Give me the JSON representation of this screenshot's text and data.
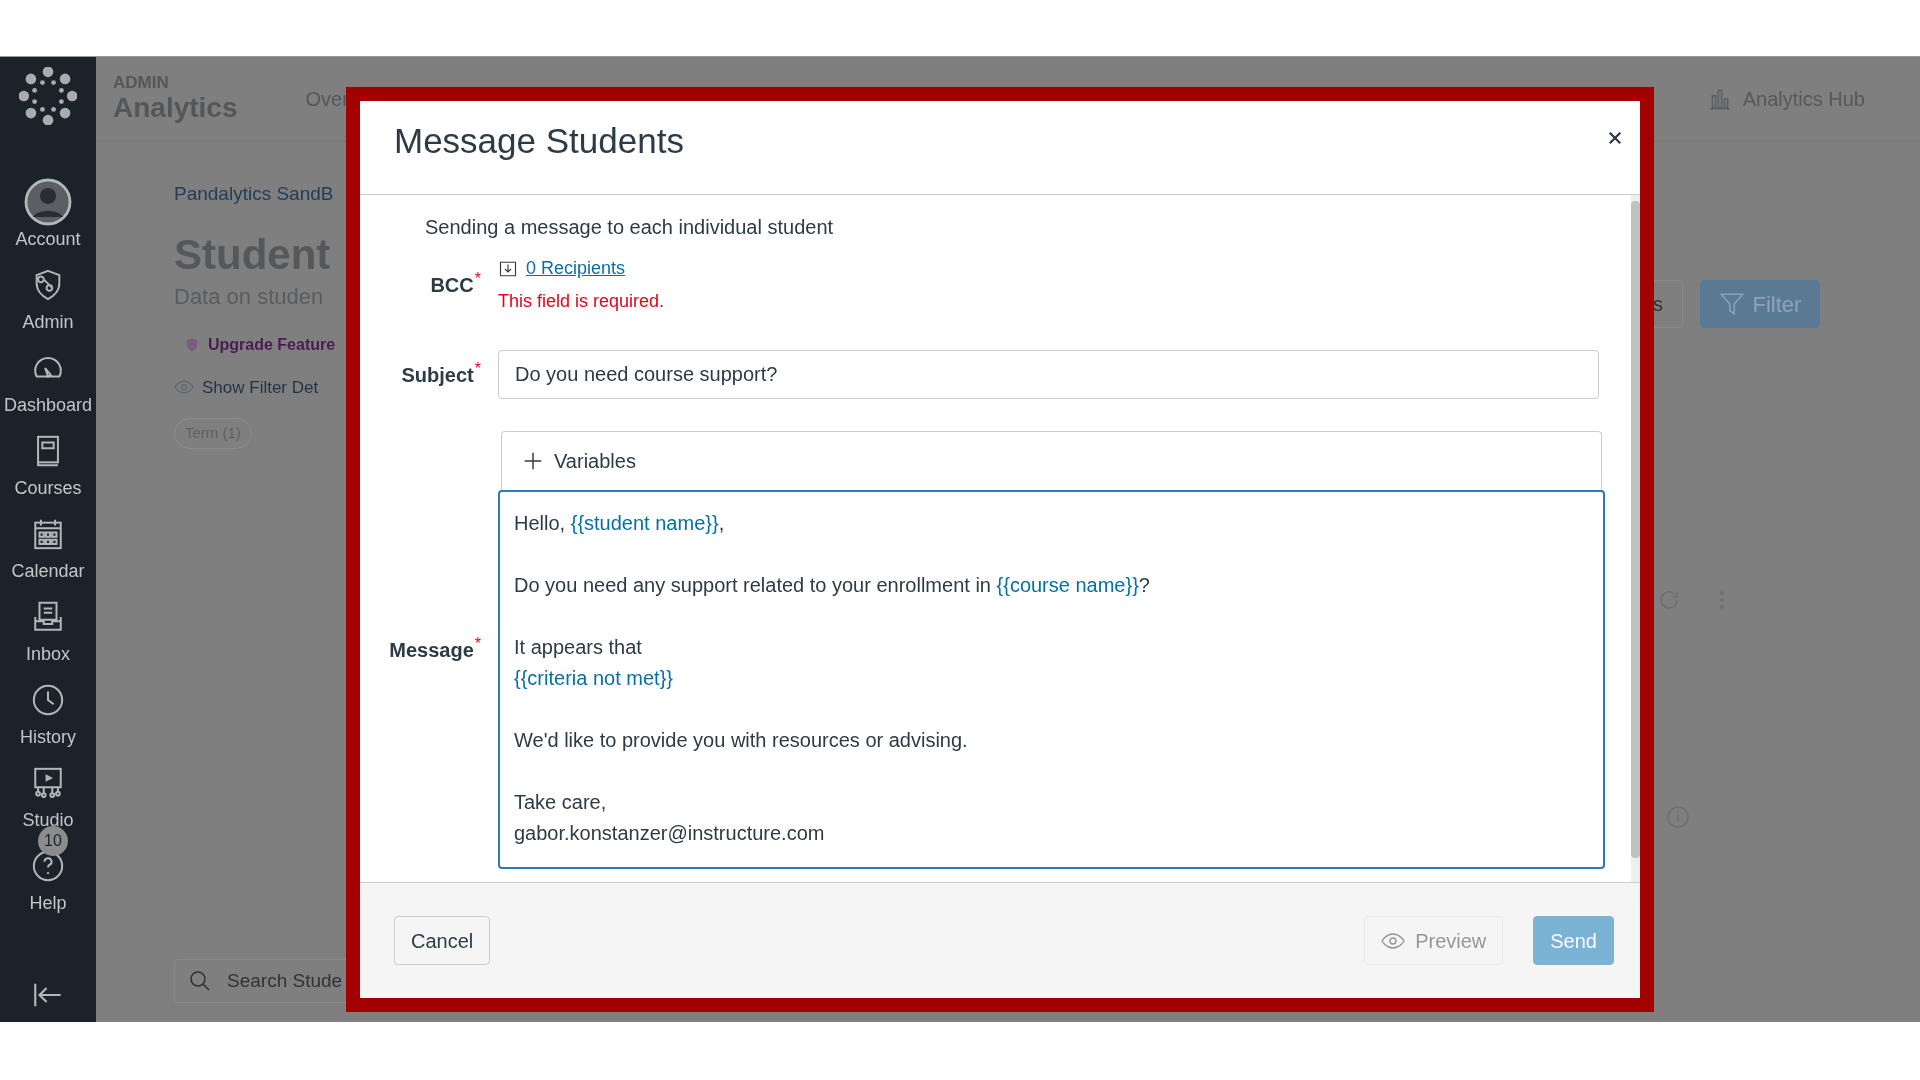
{
  "sidebar": {
    "items": [
      {
        "label": "Account",
        "kind": "account"
      },
      {
        "label": "Admin",
        "kind": "admin"
      },
      {
        "label": "Dashboard",
        "kind": "dashboard"
      },
      {
        "label": "Courses",
        "kind": "courses"
      },
      {
        "label": "Calendar",
        "kind": "calendar"
      },
      {
        "label": "Inbox",
        "kind": "inbox"
      },
      {
        "label": "History",
        "kind": "history"
      },
      {
        "label": "Studio",
        "kind": "studio"
      },
      {
        "label": "Help",
        "kind": "help",
        "badge": "10"
      }
    ]
  },
  "header": {
    "overline": "ADMIN",
    "title": "Analytics",
    "nav_tab": "Over",
    "hub_link": "Analytics Hub"
  },
  "page": {
    "breadcrumb": "Pandalytics SandB",
    "heading": "Student",
    "subheading": "Data on studen",
    "upgrade": "Upgrade Feature",
    "filter_details": "Show Filter Det",
    "term_chip": "Term (1)",
    "partial_button": "s",
    "filter_button": "Filter",
    "search": {
      "placeholder": "Search Stude"
    }
  },
  "modal": {
    "title": "Message Students",
    "intro": "Sending a message to each individual student",
    "bcc": {
      "label": "BCC",
      "required_mark": "*",
      "recipients": "0 Recipients",
      "error": "This field is required."
    },
    "subject": {
      "label": "Subject",
      "required_mark": "*",
      "value": "Do you need course support?"
    },
    "variables_button": "Variables",
    "message": {
      "label": "Message",
      "required_mark": "*",
      "focused": true,
      "paragraphs": [
        {
          "lines": [
            {
              "segments": [
                {
                  "kind": "plain",
                  "text": "Hello, "
                },
                {
                  "kind": "variable",
                  "text": "{{student name}}"
                },
                {
                  "kind": "plain",
                  "text": ","
                }
              ]
            }
          ]
        },
        {
          "lines": [
            {
              "segments": [
                {
                  "kind": "plain",
                  "text": "Do you need any support related to your enrollment in "
                },
                {
                  "kind": "variable",
                  "text": "{{course name}}"
                },
                {
                  "kind": "plain",
                  "text": "?"
                }
              ]
            }
          ]
        },
        {
          "lines": [
            {
              "segments": [
                {
                  "kind": "plain",
                  "text": "It appears that"
                }
              ]
            },
            {
              "segments": [
                {
                  "kind": "variable",
                  "text": "{{criteria not met}}"
                }
              ]
            }
          ]
        },
        {
          "lines": [
            {
              "segments": [
                {
                  "kind": "plain",
                  "text": "We'd like to provide you with resources or advising."
                }
              ]
            }
          ]
        },
        {
          "lines": [
            {
              "segments": [
                {
                  "kind": "plain",
                  "text": "Take care,"
                }
              ]
            },
            {
              "segments": [
                {
                  "kind": "plain",
                  "text": "gabor.konstanzer@instructure.com"
                }
              ]
            }
          ]
        }
      ]
    },
    "buttons": [
      {
        "kind": "cancel",
        "label": "Cancel",
        "disabled": false
      },
      {
        "kind": "preview",
        "label": "Preview",
        "disabled": true
      },
      {
        "kind": "send",
        "label": "Send",
        "disabled": true
      }
    ]
  }
}
